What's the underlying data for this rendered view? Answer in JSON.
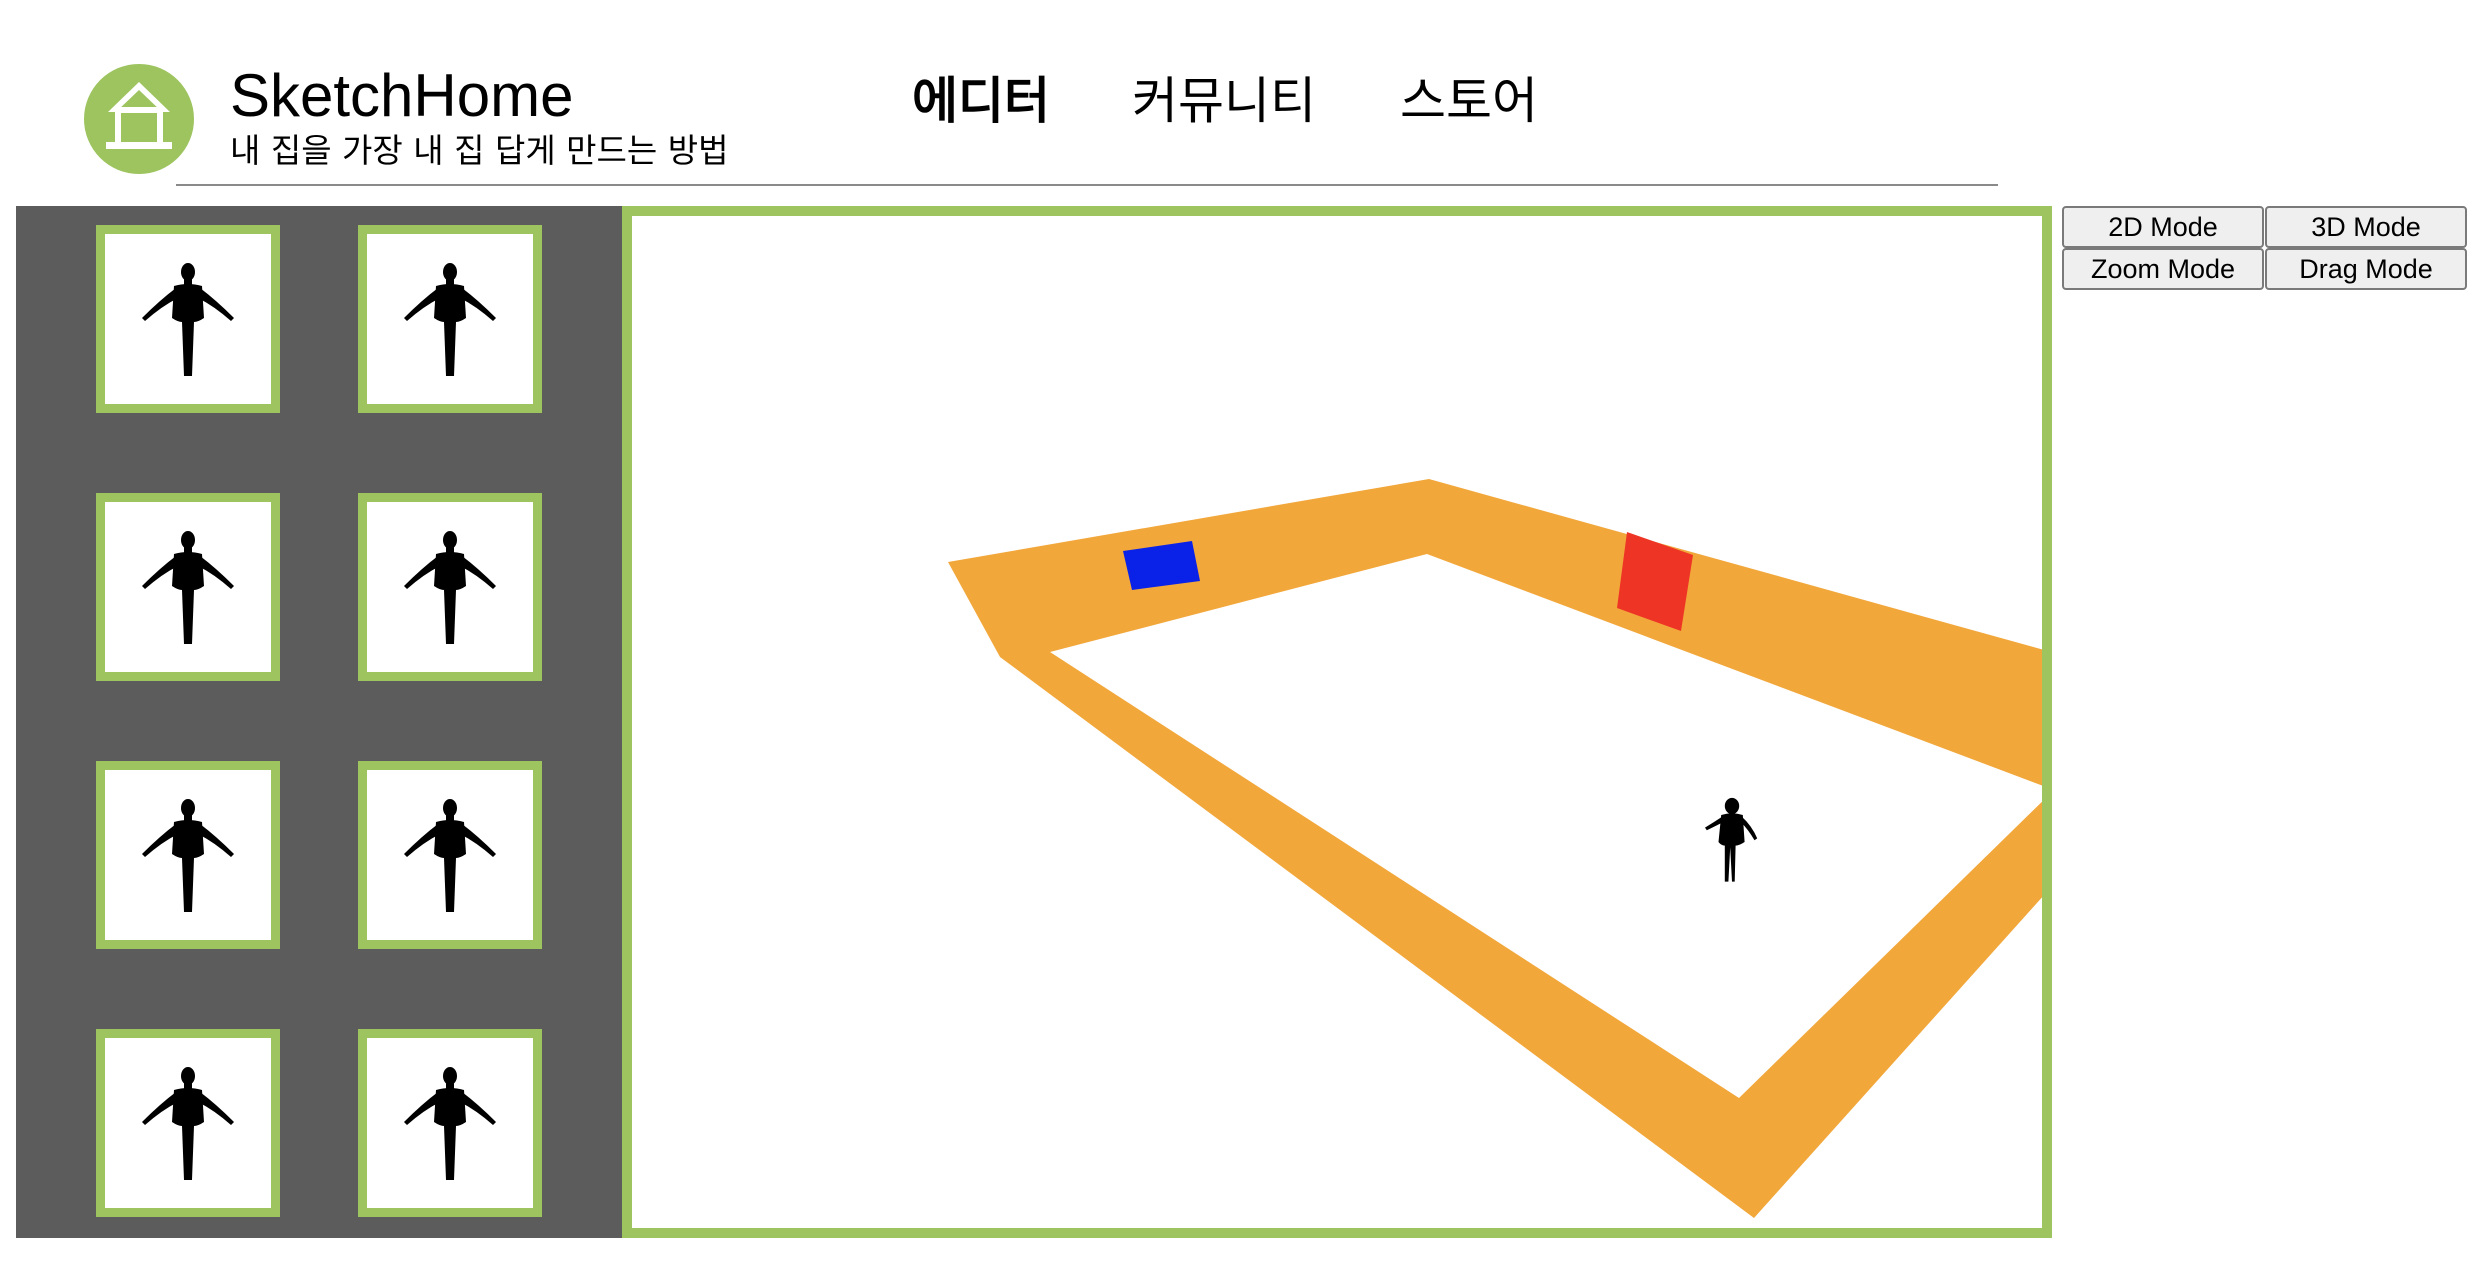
{
  "header": {
    "logo_icon": "house-icon",
    "title": "SketchHome",
    "subtitle": "내 집을 가장 내 집 답게 만드는 방법"
  },
  "nav": {
    "editor": "에디터",
    "community": "커뮤니티",
    "store": "스토어"
  },
  "sidebar": {
    "items": [
      {
        "icon": "human-figure-icon"
      },
      {
        "icon": "human-figure-icon"
      },
      {
        "icon": "human-figure-icon"
      },
      {
        "icon": "human-figure-icon"
      },
      {
        "icon": "human-figure-icon"
      },
      {
        "icon": "human-figure-icon"
      },
      {
        "icon": "human-figure-icon"
      },
      {
        "icon": "human-figure-icon"
      }
    ]
  },
  "modes": {
    "mode_2d": "2D Mode",
    "mode_3d": "3D Mode",
    "zoom": "Zoom Mode",
    "drag": "Drag Mode"
  },
  "colors": {
    "accent": "#9dc45f",
    "sidebar": "#5c5c5c",
    "wall": "#f2a73b",
    "window": "#0a22e8",
    "door": "#ee3525"
  }
}
